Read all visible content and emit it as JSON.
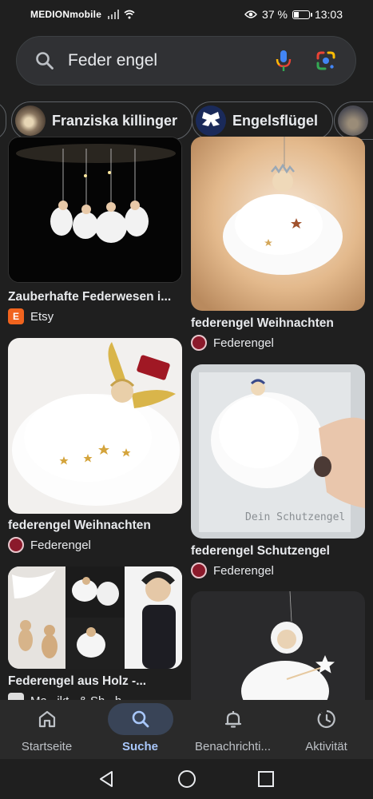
{
  "status_bar": {
    "carrier": "MEDIONmobile",
    "battery": "37 %",
    "time": "13:03",
    "battery_level": 0.37
  },
  "search": {
    "query": "Feder engel",
    "icon": "search-icon"
  },
  "chips": [
    {
      "label": "Franziska killinger"
    },
    {
      "label": "Engelsflügel"
    }
  ],
  "results": [
    {
      "title": "Zauberhafte Federwesen i...",
      "source": "Etsy",
      "favicon_letter": "E"
    },
    {
      "title": "federengel Weihnachten",
      "source": "Federengel"
    },
    {
      "title": "federengel Weihnachten",
      "source": "Federengel"
    },
    {
      "title": "federengel Schutzengel",
      "source": "Federengel",
      "image_text": "Dein Schutzengel"
    },
    {
      "title": "Federengel aus Holz -...",
      "source": "Ma...ikt...& Sh...h"
    },
    {
      "title": "",
      "source": ""
    }
  ],
  "bottom_nav": [
    {
      "label": "Startseite",
      "icon": "home-icon"
    },
    {
      "label": "Suche",
      "icon": "search-icon",
      "active": true
    },
    {
      "label": "Benachrichti...",
      "icon": "bell-icon"
    },
    {
      "label": "Aktivität",
      "icon": "activity-icon"
    }
  ],
  "colors": {
    "background": "#1f1f1f",
    "search_bg": "#303134",
    "accent": "#a8c7fa",
    "etsy": "#f1641e",
    "federengel": "#8b1a2b"
  }
}
